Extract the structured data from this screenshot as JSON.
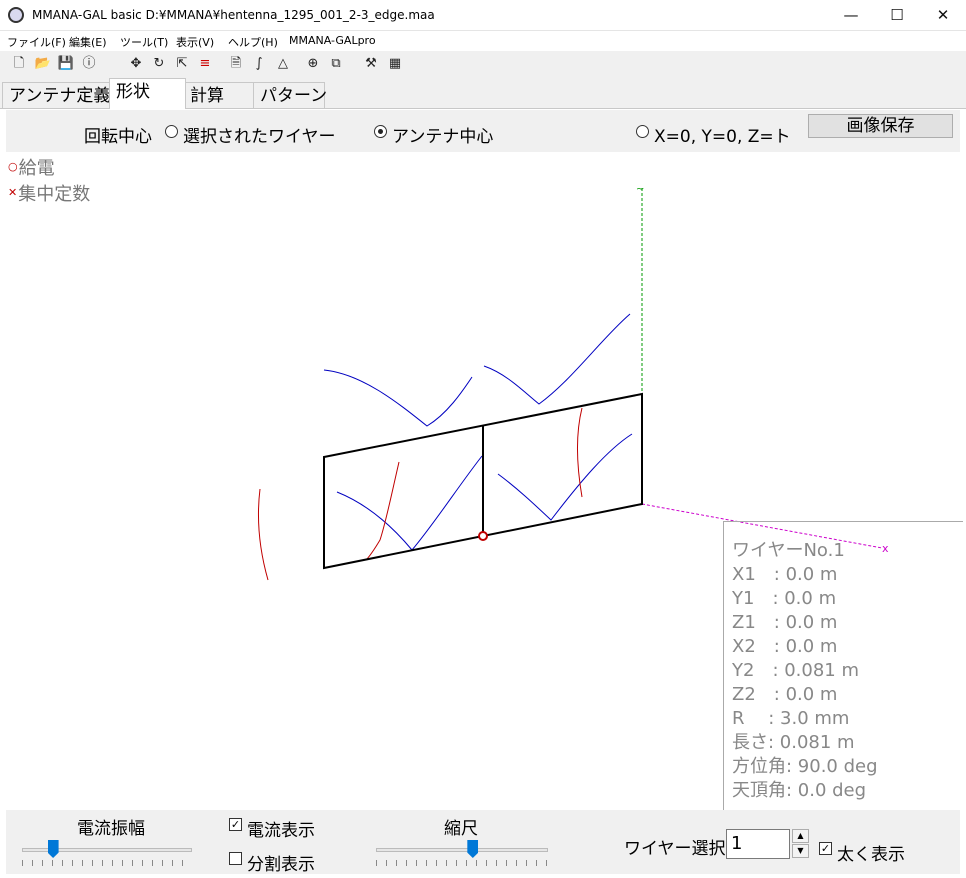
{
  "window": {
    "title": "MMANA-GAL basic D:¥MMANA¥hentenna_1295_001_2-3_edge.maa"
  },
  "menu": [
    "ファイル(F)",
    "編集(E)",
    "ツール(T)",
    "表示(V)",
    "ヘルプ(H)",
    "MMANA-GALpro"
  ],
  "toolbar": [
    "new-file-icon",
    "open-folder-icon",
    "save-icon",
    "info-icon",
    "move-icon",
    "rotate-icon",
    "zoom-icon",
    "wire-list-icon",
    "document-icon",
    "pen-icon",
    "triangle-icon",
    "target-icon",
    "copy-icon",
    "tools-icon",
    "calculator-icon"
  ],
  "tabs": [
    "アンテナ定義",
    "形状",
    "計算",
    "パターン"
  ],
  "active_tab": "形状",
  "rotation": {
    "label": "回転中心",
    "options": [
      "選択されたワイヤー",
      "アンテナ中心",
      "X=0, Y=0, Z=ト"
    ],
    "selected": "アンテナ中心"
  },
  "save_image_label": "画像保存",
  "legend": {
    "feed": "給電",
    "load": "集中定数"
  },
  "colors": {
    "wire": "#000000",
    "current": "#0000c0",
    "phase": "#c00000",
    "axis_z": "#009900",
    "axis_y": "#cc00cc"
  },
  "wire_info": {
    "title": "ワイヤーNo.1",
    "lines": [
      "X1　:  0.0 m",
      "Y1　:  0.0 m",
      "Z1　:  0.0 m",
      "X2　:  0.0 m",
      "Y2　:  0.081 m",
      "Z2　:  0.0 m",
      "R　 :  3.0 mm",
      "長さ:  0.081 m",
      "方位角:  90.0 deg",
      "天頂角:  0.0 deg"
    ]
  },
  "bottom": {
    "current_amp_label": "電流振幅",
    "current_amp_level": 0.18,
    "show_current_label": "電流表示",
    "show_current_checked": true,
    "show_segments_label": "分割表示",
    "show_segments_checked": false,
    "scale_label": "縮尺",
    "scale_level": 0.56,
    "wire_select_label": "ワイヤー選択",
    "wire_select_value": "1",
    "bold_label": "太く表示",
    "bold_checked": true
  }
}
